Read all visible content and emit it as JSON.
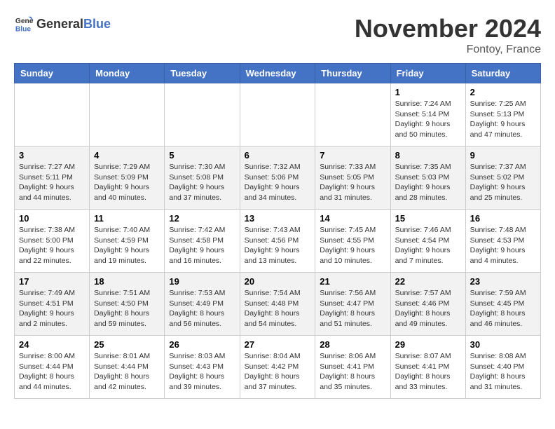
{
  "header": {
    "logo_general": "General",
    "logo_blue": "Blue",
    "month": "November 2024",
    "location": "Fontoy, France"
  },
  "weekdays": [
    "Sunday",
    "Monday",
    "Tuesday",
    "Wednesday",
    "Thursday",
    "Friday",
    "Saturday"
  ],
  "weeks": [
    [
      {
        "day": "",
        "info": ""
      },
      {
        "day": "",
        "info": ""
      },
      {
        "day": "",
        "info": ""
      },
      {
        "day": "",
        "info": ""
      },
      {
        "day": "",
        "info": ""
      },
      {
        "day": "1",
        "info": "Sunrise: 7:24 AM\nSunset: 5:14 PM\nDaylight: 9 hours and 50 minutes."
      },
      {
        "day": "2",
        "info": "Sunrise: 7:25 AM\nSunset: 5:13 PM\nDaylight: 9 hours and 47 minutes."
      }
    ],
    [
      {
        "day": "3",
        "info": "Sunrise: 7:27 AM\nSunset: 5:11 PM\nDaylight: 9 hours and 44 minutes."
      },
      {
        "day": "4",
        "info": "Sunrise: 7:29 AM\nSunset: 5:09 PM\nDaylight: 9 hours and 40 minutes."
      },
      {
        "day": "5",
        "info": "Sunrise: 7:30 AM\nSunset: 5:08 PM\nDaylight: 9 hours and 37 minutes."
      },
      {
        "day": "6",
        "info": "Sunrise: 7:32 AM\nSunset: 5:06 PM\nDaylight: 9 hours and 34 minutes."
      },
      {
        "day": "7",
        "info": "Sunrise: 7:33 AM\nSunset: 5:05 PM\nDaylight: 9 hours and 31 minutes."
      },
      {
        "day": "8",
        "info": "Sunrise: 7:35 AM\nSunset: 5:03 PM\nDaylight: 9 hours and 28 minutes."
      },
      {
        "day": "9",
        "info": "Sunrise: 7:37 AM\nSunset: 5:02 PM\nDaylight: 9 hours and 25 minutes."
      }
    ],
    [
      {
        "day": "10",
        "info": "Sunrise: 7:38 AM\nSunset: 5:00 PM\nDaylight: 9 hours and 22 minutes."
      },
      {
        "day": "11",
        "info": "Sunrise: 7:40 AM\nSunset: 4:59 PM\nDaylight: 9 hours and 19 minutes."
      },
      {
        "day": "12",
        "info": "Sunrise: 7:42 AM\nSunset: 4:58 PM\nDaylight: 9 hours and 16 minutes."
      },
      {
        "day": "13",
        "info": "Sunrise: 7:43 AM\nSunset: 4:56 PM\nDaylight: 9 hours and 13 minutes."
      },
      {
        "day": "14",
        "info": "Sunrise: 7:45 AM\nSunset: 4:55 PM\nDaylight: 9 hours and 10 minutes."
      },
      {
        "day": "15",
        "info": "Sunrise: 7:46 AM\nSunset: 4:54 PM\nDaylight: 9 hours and 7 minutes."
      },
      {
        "day": "16",
        "info": "Sunrise: 7:48 AM\nSunset: 4:53 PM\nDaylight: 9 hours and 4 minutes."
      }
    ],
    [
      {
        "day": "17",
        "info": "Sunrise: 7:49 AM\nSunset: 4:51 PM\nDaylight: 9 hours and 2 minutes."
      },
      {
        "day": "18",
        "info": "Sunrise: 7:51 AM\nSunset: 4:50 PM\nDaylight: 8 hours and 59 minutes."
      },
      {
        "day": "19",
        "info": "Sunrise: 7:53 AM\nSunset: 4:49 PM\nDaylight: 8 hours and 56 minutes."
      },
      {
        "day": "20",
        "info": "Sunrise: 7:54 AM\nSunset: 4:48 PM\nDaylight: 8 hours and 54 minutes."
      },
      {
        "day": "21",
        "info": "Sunrise: 7:56 AM\nSunset: 4:47 PM\nDaylight: 8 hours and 51 minutes."
      },
      {
        "day": "22",
        "info": "Sunrise: 7:57 AM\nSunset: 4:46 PM\nDaylight: 8 hours and 49 minutes."
      },
      {
        "day": "23",
        "info": "Sunrise: 7:59 AM\nSunset: 4:45 PM\nDaylight: 8 hours and 46 minutes."
      }
    ],
    [
      {
        "day": "24",
        "info": "Sunrise: 8:00 AM\nSunset: 4:44 PM\nDaylight: 8 hours and 44 minutes."
      },
      {
        "day": "25",
        "info": "Sunrise: 8:01 AM\nSunset: 4:44 PM\nDaylight: 8 hours and 42 minutes."
      },
      {
        "day": "26",
        "info": "Sunrise: 8:03 AM\nSunset: 4:43 PM\nDaylight: 8 hours and 39 minutes."
      },
      {
        "day": "27",
        "info": "Sunrise: 8:04 AM\nSunset: 4:42 PM\nDaylight: 8 hours and 37 minutes."
      },
      {
        "day": "28",
        "info": "Sunrise: 8:06 AM\nSunset: 4:41 PM\nDaylight: 8 hours and 35 minutes."
      },
      {
        "day": "29",
        "info": "Sunrise: 8:07 AM\nSunset: 4:41 PM\nDaylight: 8 hours and 33 minutes."
      },
      {
        "day": "30",
        "info": "Sunrise: 8:08 AM\nSunset: 4:40 PM\nDaylight: 8 hours and 31 minutes."
      }
    ]
  ]
}
